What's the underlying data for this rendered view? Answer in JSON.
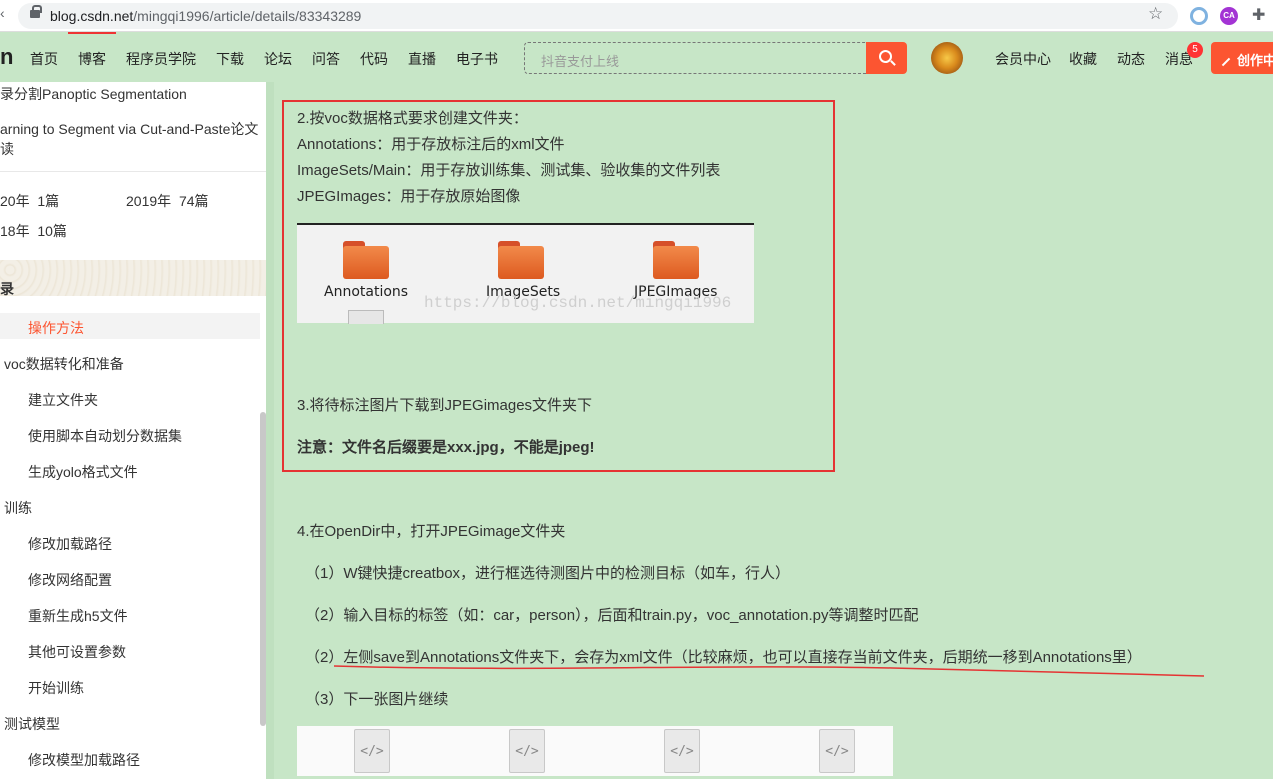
{
  "browser": {
    "url_host": "blog.csdn.net",
    "url_path": "/mingqi1996/article/details/83343289",
    "icons": [
      "lock-icon",
      "star-icon",
      "extension-icon",
      "puzzle-icon"
    ]
  },
  "header": {
    "logo": "n",
    "nav": [
      "首页",
      "博客",
      "程序员学院",
      "下载",
      "论坛",
      "问答",
      "代码",
      "直播",
      "电子书"
    ],
    "search_placeholder": "抖音支付上线",
    "links": [
      "会员中心",
      "收藏",
      "动态",
      "消息"
    ],
    "message_badge": "5",
    "create_label": "创作中"
  },
  "sidebar": {
    "articles": [
      "录分割Panoptic Segmentation",
      "arning to Segment via Cut-and-Paste论文",
      "读"
    ],
    "archive": [
      [
        "20年",
        "1篇"
      ],
      [
        "2019年",
        "74篇"
      ],
      [
        "18年",
        "10篇"
      ]
    ],
    "toc_title": "录",
    "toc": [
      {
        "label": "操作方法",
        "level": 2,
        "active": true
      },
      {
        "label": "voc数据转化和准备",
        "level": 1
      },
      {
        "label": "建立文件夹",
        "level": 2
      },
      {
        "label": "使用脚本自动划分数据集",
        "level": 2
      },
      {
        "label": "生成yolo格式文件",
        "level": 2
      },
      {
        "label": "训练",
        "level": 1
      },
      {
        "label": "修改加载路径",
        "level": 2
      },
      {
        "label": "修改网络配置",
        "level": 2
      },
      {
        "label": "重新生成h5文件",
        "level": 2
      },
      {
        "label": "其他可设置参数",
        "level": 2
      },
      {
        "label": "开始训练",
        "level": 2
      },
      {
        "label": "测试模型",
        "level": 1
      },
      {
        "label": "修改模型加载路径",
        "level": 2
      }
    ]
  },
  "article": {
    "step2": "2.按voc数据格式要求创建文件夹：",
    "annotations_line": "Annotations：用于存放标注后的xml文件",
    "imagesets_line": "ImageSets/Main：用于存放训练集、测试集、验收集的文件列表",
    "jpeg_line": "JPEGImages：用于存放原始图像",
    "folders": [
      "Annotations",
      "ImageSets",
      "JPEGImages"
    ],
    "watermark": "https://blog.csdn.net/mingqi1996",
    "step3": "3.将待标注图片下载到JPEGimages文件夹下",
    "note": "注意：文件名后缀要是xxx.jpg，不能是jpeg!",
    "step4": "4.在OpenDir中，打开JPEGimage文件夹",
    "sub1": "（1）W键快捷creatbox，进行框选待测图片中的检测目标（如车，行人）",
    "sub2": "（2）输入目标的标签（如：car，person），后面和train.py，voc_annotation.py等调整时匹配",
    "sub3": "（2）左侧save到Annotations文件夹下，会存为xml文件（比较麻烦，也可以直接存当前文件夹，后期统一移到Annotations里）",
    "sub4": "（3）下一张图片继续",
    "file_icon_glyph": "</>"
  },
  "colors": {
    "accent": "#fc5531",
    "highlight_box": "#e53333",
    "page_bg": "#c7e6c7"
  }
}
